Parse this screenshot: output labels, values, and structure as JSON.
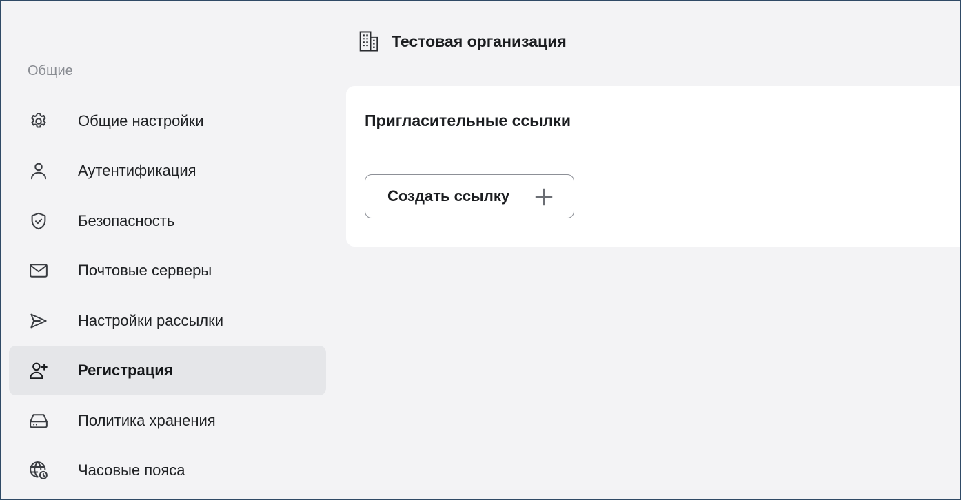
{
  "organization": {
    "title": "Тестовая организация",
    "icon": "building-icon"
  },
  "sidebar": {
    "section_label": "Общие",
    "items": [
      {
        "label": "Общие настройки",
        "icon": "gear-icon",
        "active": false
      },
      {
        "label": "Аутентификация",
        "icon": "user-icon",
        "active": false
      },
      {
        "label": "Безопасность",
        "icon": "shield-check-icon",
        "active": false
      },
      {
        "label": "Почтовые серверы",
        "icon": "mail-icon",
        "active": false
      },
      {
        "label": "Настройки рассылки",
        "icon": "send-icon",
        "active": false
      },
      {
        "label": "Регистрация",
        "icon": "user-plus-icon",
        "active": true
      },
      {
        "label": "Политика хранения",
        "icon": "storage-drive-icon",
        "active": false
      },
      {
        "label": "Часовые пояса",
        "icon": "globe-clock-icon",
        "active": false
      }
    ]
  },
  "invite_links": {
    "title": "Пригласительные ссылки",
    "create_button_label": "Создать ссылку",
    "create_button_icon": "plus-icon"
  },
  "colors": {
    "frame_border": "#2f4a66",
    "background": "#f3f3f5",
    "card": "#ffffff",
    "active_item": "#e5e6e9",
    "muted_text": "#8a8d93"
  }
}
